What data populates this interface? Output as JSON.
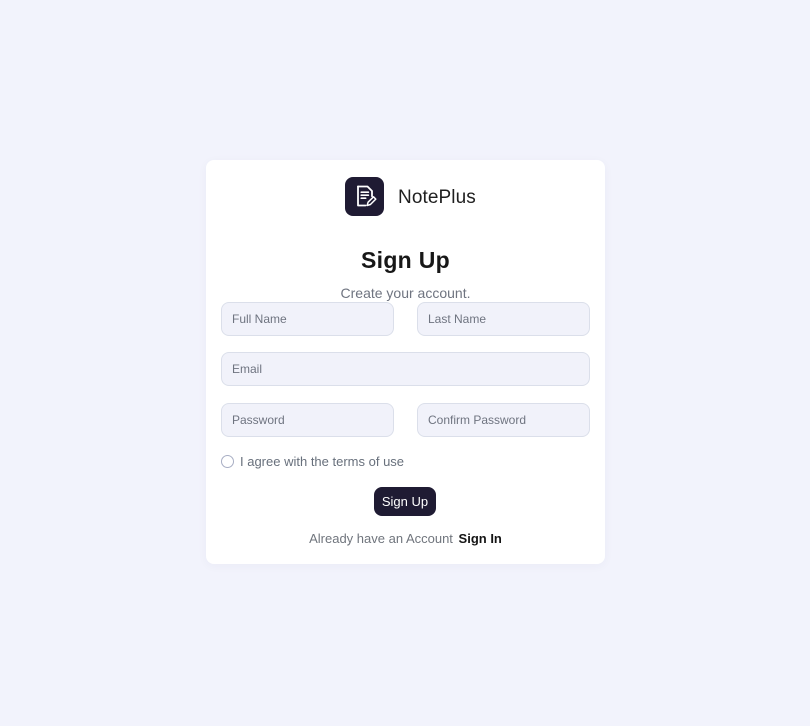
{
  "brand": {
    "name": "NotePlus",
    "logo_icon": "note-edit-icon",
    "logo_color": "#1f1b33"
  },
  "page": {
    "title": "Sign Up",
    "subtitle": "Create your account."
  },
  "form": {
    "full_name": {
      "value": "",
      "placeholder": "Full Name"
    },
    "last_name": {
      "value": "",
      "placeholder": "Last Name"
    },
    "email": {
      "value": "",
      "placeholder": "Email"
    },
    "password": {
      "value": "",
      "placeholder": "Password"
    },
    "confirm_password": {
      "value": "",
      "placeholder": "Confirm Password"
    },
    "terms": {
      "checked": false,
      "label": "I agree with the terms of use"
    },
    "submit_label": "Sign Up"
  },
  "footer": {
    "prompt": "Already have an Account",
    "link_label": "Sign In"
  },
  "colors": {
    "background": "#f2f3fc",
    "card": "#ffffff",
    "accent": "#1f1b33",
    "input_background": "#f1f2fa",
    "input_border": "#dbdfea"
  }
}
